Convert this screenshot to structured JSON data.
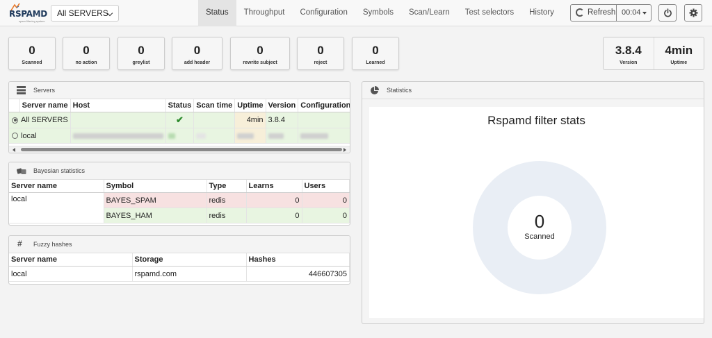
{
  "brand": {
    "name": "RSPAMD",
    "tagline": "spam filtering system"
  },
  "server_select": {
    "value": "All SERVERS"
  },
  "nav": {
    "tabs": [
      "Status",
      "Throughput",
      "Configuration",
      "Symbols",
      "Scan/Learn",
      "Test selectors",
      "History"
    ],
    "active": "Status"
  },
  "toolbar": {
    "refresh_label": "Refresh",
    "interval": "00:04"
  },
  "stats": [
    {
      "value": "0",
      "label": "Scanned"
    },
    {
      "value": "0",
      "label": "no action"
    },
    {
      "value": "0",
      "label": "greylist"
    },
    {
      "value": "0",
      "label": "add header"
    },
    {
      "value": "0",
      "label": "rewrite subject"
    },
    {
      "value": "0",
      "label": "reject"
    },
    {
      "value": "0",
      "label": "Learned"
    }
  ],
  "version_info": {
    "version": "3.8.4",
    "version_label": "Version",
    "uptime": "4min",
    "uptime_label": "Uptime"
  },
  "servers": {
    "title": "Servers",
    "columns": [
      "Server name",
      "Host",
      "Status",
      "Scan time",
      "Uptime",
      "Version",
      "Configuration ID"
    ],
    "rows": [
      {
        "name": "All SERVERS",
        "host": "",
        "status": "ok",
        "scan_time": "",
        "uptime": "4min",
        "version": "3.8.4",
        "config_id": "",
        "selected": true
      },
      {
        "name": "local",
        "blurred": true,
        "selected": false
      }
    ]
  },
  "bayes": {
    "title": "Bayesian statistics",
    "columns": [
      "Server name",
      "Symbol",
      "Type",
      "Learns",
      "Users"
    ],
    "rows": [
      {
        "server": "local",
        "symbol": "BAYES_SPAM",
        "type": "redis",
        "learns": "0",
        "users": "0",
        "tone": "red"
      },
      {
        "server": "",
        "symbol": "BAYES_HAM",
        "type": "redis",
        "learns": "0",
        "users": "0",
        "tone": "green"
      }
    ]
  },
  "fuzzy": {
    "title": "Fuzzy hashes",
    "columns": [
      "Server name",
      "Storage",
      "Hashes"
    ],
    "rows": [
      {
        "server": "local",
        "storage": "rspamd.com",
        "hashes": "446607305"
      }
    ]
  },
  "statistics": {
    "title": "Statistics",
    "chart_title": "Rspamd filter stats",
    "center_value": "0",
    "center_label": "Scanned",
    "ring_color": "#e9eef5"
  },
  "chart_data": {
    "type": "pie",
    "title": "Rspamd filter stats",
    "categories": [
      "Scanned"
    ],
    "values": [
      0
    ],
    "center_total": 0
  }
}
